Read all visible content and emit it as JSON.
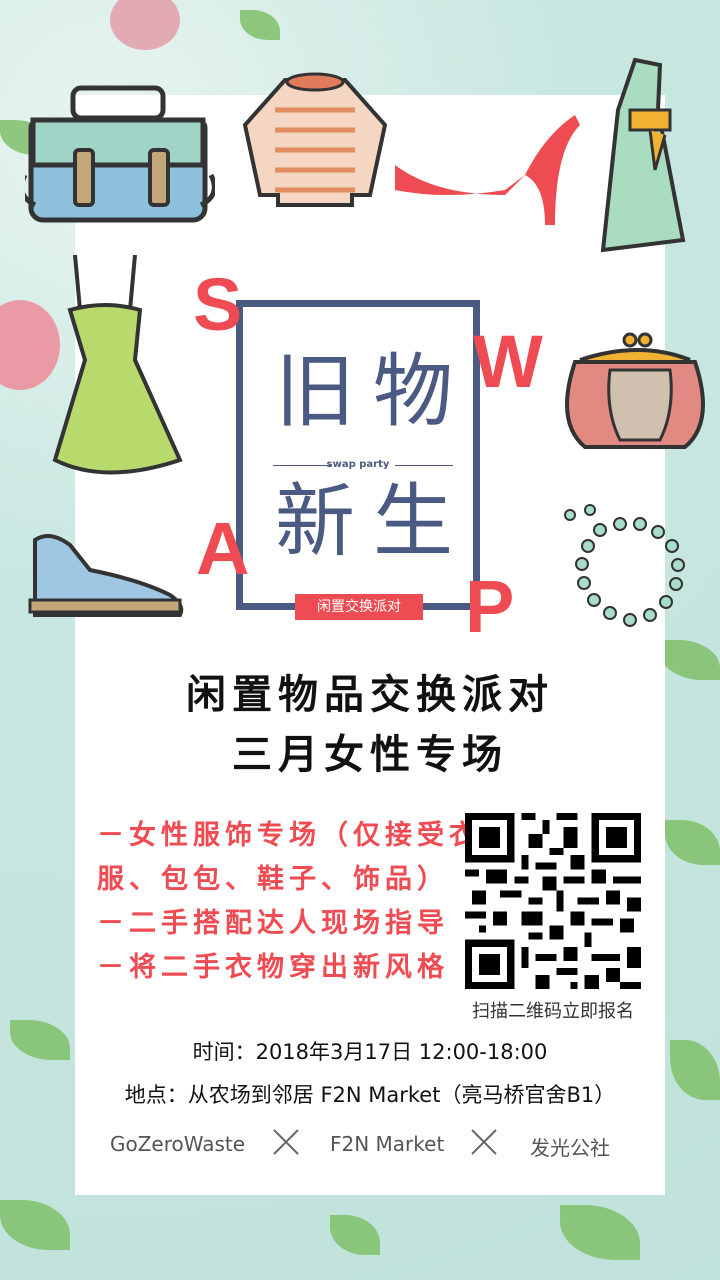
{
  "poster": {
    "title_chars": [
      "旧",
      "物",
      "新",
      "生"
    ],
    "swap_letters": [
      "S",
      "W",
      "A",
      "P"
    ],
    "swap_party": "swap party",
    "tag": "闲置交换派对",
    "headline_1": "闲置物品交换派对",
    "headline_2": "三月女性专场",
    "bullets": [
      "－女性服饰专场（仅接受衣",
      "服、包包、鞋子、饰品）",
      "－二手搭配达人现场指导",
      "－将二手衣物穿出新风格"
    ],
    "qr_caption": "扫描二维码立即报名",
    "time": "时间：2018年3月17日 12:00-18:00",
    "location": "地点：从农场到邻居 F2N Market（亮马桥官舍B1）",
    "sponsors": [
      "GoZeroWaste",
      "F2N Market",
      "发光公社"
    ]
  },
  "icons": [
    "bag-icon",
    "sweater-icon",
    "high-heel-icon",
    "long-dress-icon",
    "green-dress-icon",
    "purse-icon",
    "shoe-icon",
    "necklace-icon",
    "qr-code-icon"
  ],
  "colors": {
    "accent": "#ef4b52",
    "frame": "#4a5a82",
    "background": "#c9e7e1"
  }
}
